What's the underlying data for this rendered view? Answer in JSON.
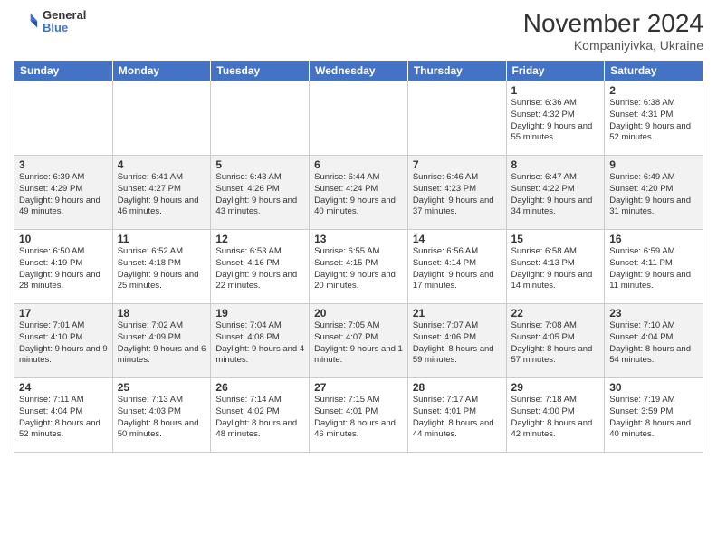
{
  "header": {
    "logo_general": "General",
    "logo_blue": "Blue",
    "month_year": "November 2024",
    "location": "Kompaniyivka, Ukraine"
  },
  "weekdays": [
    "Sunday",
    "Monday",
    "Tuesday",
    "Wednesday",
    "Thursday",
    "Friday",
    "Saturday"
  ],
  "weeks": [
    [
      {
        "day": "",
        "sunrise": "",
        "sunset": "",
        "daylight": ""
      },
      {
        "day": "",
        "sunrise": "",
        "sunset": "",
        "daylight": ""
      },
      {
        "day": "",
        "sunrise": "",
        "sunset": "",
        "daylight": ""
      },
      {
        "day": "",
        "sunrise": "",
        "sunset": "",
        "daylight": ""
      },
      {
        "day": "",
        "sunrise": "",
        "sunset": "",
        "daylight": ""
      },
      {
        "day": "1",
        "sunrise": "Sunrise: 6:36 AM",
        "sunset": "Sunset: 4:32 PM",
        "daylight": "Daylight: 9 hours and 55 minutes."
      },
      {
        "day": "2",
        "sunrise": "Sunrise: 6:38 AM",
        "sunset": "Sunset: 4:31 PM",
        "daylight": "Daylight: 9 hours and 52 minutes."
      }
    ],
    [
      {
        "day": "3",
        "sunrise": "Sunrise: 6:39 AM",
        "sunset": "Sunset: 4:29 PM",
        "daylight": "Daylight: 9 hours and 49 minutes."
      },
      {
        "day": "4",
        "sunrise": "Sunrise: 6:41 AM",
        "sunset": "Sunset: 4:27 PM",
        "daylight": "Daylight: 9 hours and 46 minutes."
      },
      {
        "day": "5",
        "sunrise": "Sunrise: 6:43 AM",
        "sunset": "Sunset: 4:26 PM",
        "daylight": "Daylight: 9 hours and 43 minutes."
      },
      {
        "day": "6",
        "sunrise": "Sunrise: 6:44 AM",
        "sunset": "Sunset: 4:24 PM",
        "daylight": "Daylight: 9 hours and 40 minutes."
      },
      {
        "day": "7",
        "sunrise": "Sunrise: 6:46 AM",
        "sunset": "Sunset: 4:23 PM",
        "daylight": "Daylight: 9 hours and 37 minutes."
      },
      {
        "day": "8",
        "sunrise": "Sunrise: 6:47 AM",
        "sunset": "Sunset: 4:22 PM",
        "daylight": "Daylight: 9 hours and 34 minutes."
      },
      {
        "day": "9",
        "sunrise": "Sunrise: 6:49 AM",
        "sunset": "Sunset: 4:20 PM",
        "daylight": "Daylight: 9 hours and 31 minutes."
      }
    ],
    [
      {
        "day": "10",
        "sunrise": "Sunrise: 6:50 AM",
        "sunset": "Sunset: 4:19 PM",
        "daylight": "Daylight: 9 hours and 28 minutes."
      },
      {
        "day": "11",
        "sunrise": "Sunrise: 6:52 AM",
        "sunset": "Sunset: 4:18 PM",
        "daylight": "Daylight: 9 hours and 25 minutes."
      },
      {
        "day": "12",
        "sunrise": "Sunrise: 6:53 AM",
        "sunset": "Sunset: 4:16 PM",
        "daylight": "Daylight: 9 hours and 22 minutes."
      },
      {
        "day": "13",
        "sunrise": "Sunrise: 6:55 AM",
        "sunset": "Sunset: 4:15 PM",
        "daylight": "Daylight: 9 hours and 20 minutes."
      },
      {
        "day": "14",
        "sunrise": "Sunrise: 6:56 AM",
        "sunset": "Sunset: 4:14 PM",
        "daylight": "Daylight: 9 hours and 17 minutes."
      },
      {
        "day": "15",
        "sunrise": "Sunrise: 6:58 AM",
        "sunset": "Sunset: 4:13 PM",
        "daylight": "Daylight: 9 hours and 14 minutes."
      },
      {
        "day": "16",
        "sunrise": "Sunrise: 6:59 AM",
        "sunset": "Sunset: 4:11 PM",
        "daylight": "Daylight: 9 hours and 11 minutes."
      }
    ],
    [
      {
        "day": "17",
        "sunrise": "Sunrise: 7:01 AM",
        "sunset": "Sunset: 4:10 PM",
        "daylight": "Daylight: 9 hours and 9 minutes."
      },
      {
        "day": "18",
        "sunrise": "Sunrise: 7:02 AM",
        "sunset": "Sunset: 4:09 PM",
        "daylight": "Daylight: 9 hours and 6 minutes."
      },
      {
        "day": "19",
        "sunrise": "Sunrise: 7:04 AM",
        "sunset": "Sunset: 4:08 PM",
        "daylight": "Daylight: 9 hours and 4 minutes."
      },
      {
        "day": "20",
        "sunrise": "Sunrise: 7:05 AM",
        "sunset": "Sunset: 4:07 PM",
        "daylight": "Daylight: 9 hours and 1 minute."
      },
      {
        "day": "21",
        "sunrise": "Sunrise: 7:07 AM",
        "sunset": "Sunset: 4:06 PM",
        "daylight": "Daylight: 8 hours and 59 minutes."
      },
      {
        "day": "22",
        "sunrise": "Sunrise: 7:08 AM",
        "sunset": "Sunset: 4:05 PM",
        "daylight": "Daylight: 8 hours and 57 minutes."
      },
      {
        "day": "23",
        "sunrise": "Sunrise: 7:10 AM",
        "sunset": "Sunset: 4:04 PM",
        "daylight": "Daylight: 8 hours and 54 minutes."
      }
    ],
    [
      {
        "day": "24",
        "sunrise": "Sunrise: 7:11 AM",
        "sunset": "Sunset: 4:04 PM",
        "daylight": "Daylight: 8 hours and 52 minutes."
      },
      {
        "day": "25",
        "sunrise": "Sunrise: 7:13 AM",
        "sunset": "Sunset: 4:03 PM",
        "daylight": "Daylight: 8 hours and 50 minutes."
      },
      {
        "day": "26",
        "sunrise": "Sunrise: 7:14 AM",
        "sunset": "Sunset: 4:02 PM",
        "daylight": "Daylight: 8 hours and 48 minutes."
      },
      {
        "day": "27",
        "sunrise": "Sunrise: 7:15 AM",
        "sunset": "Sunset: 4:01 PM",
        "daylight": "Daylight: 8 hours and 46 minutes."
      },
      {
        "day": "28",
        "sunrise": "Sunrise: 7:17 AM",
        "sunset": "Sunset: 4:01 PM",
        "daylight": "Daylight: 8 hours and 44 minutes."
      },
      {
        "day": "29",
        "sunrise": "Sunrise: 7:18 AM",
        "sunset": "Sunset: 4:00 PM",
        "daylight": "Daylight: 8 hours and 42 minutes."
      },
      {
        "day": "30",
        "sunrise": "Sunrise: 7:19 AM",
        "sunset": "Sunset: 3:59 PM",
        "daylight": "Daylight: 8 hours and 40 minutes."
      }
    ]
  ]
}
